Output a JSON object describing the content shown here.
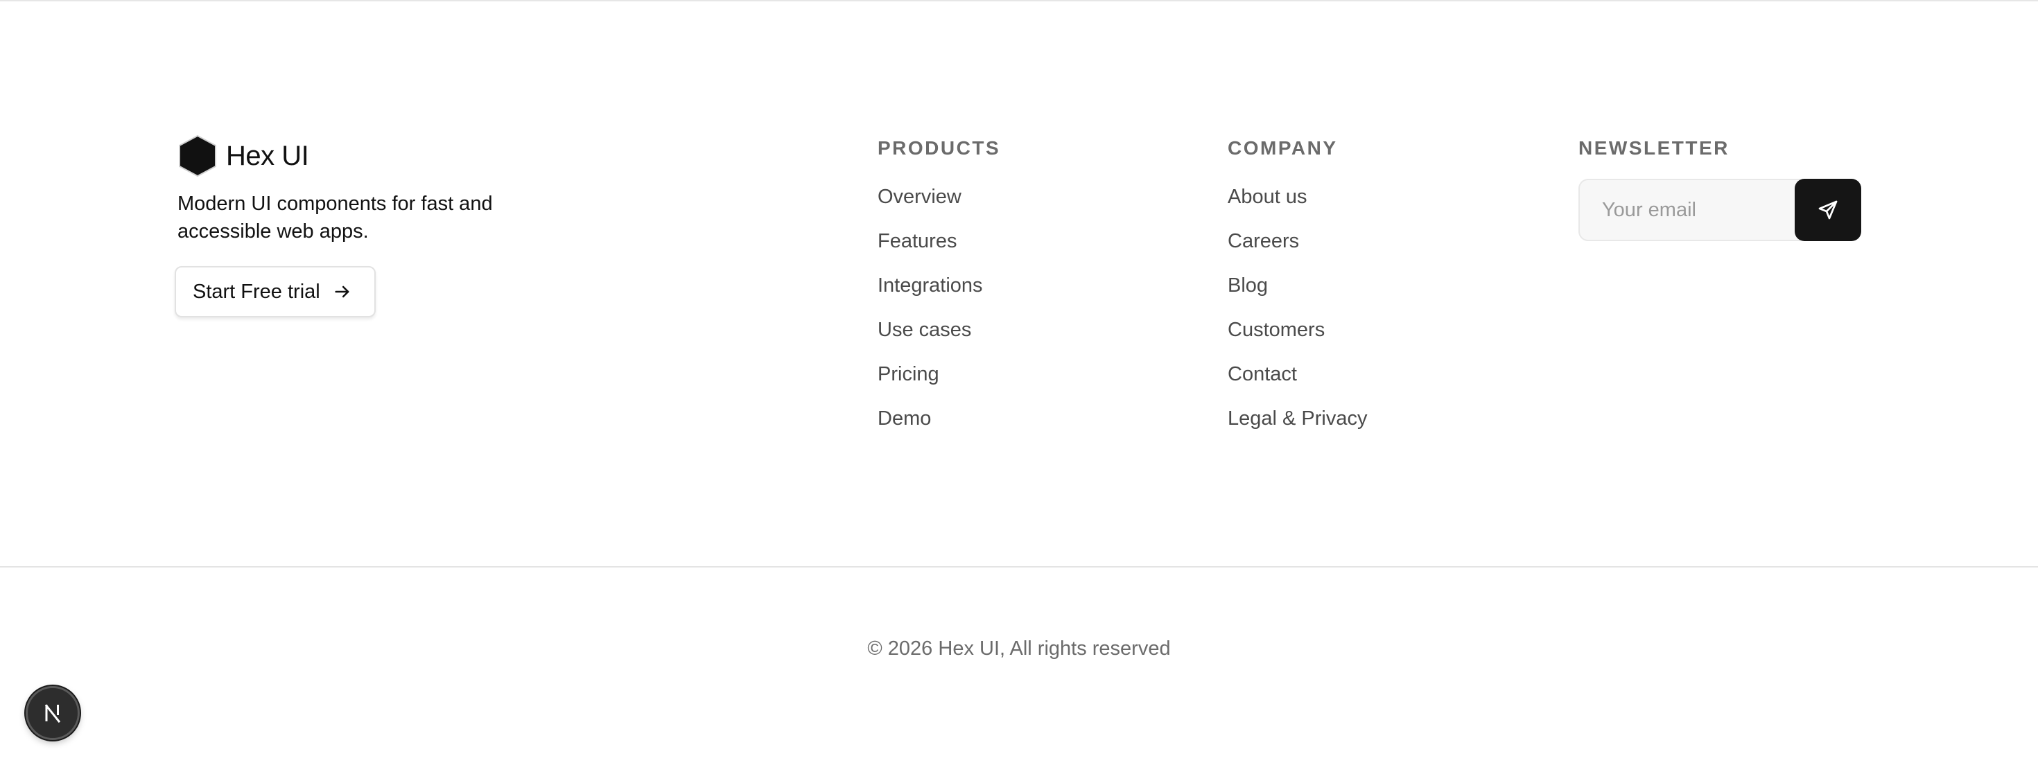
{
  "brand": {
    "name": "Hex UI",
    "logo_icon": "hexagon-icon",
    "tagline": "Modern UI components for fast and accessible web apps.",
    "cta_label": "Start Free trial",
    "cta_icon": "arrow-right-icon"
  },
  "products": {
    "heading": "PRODUCTS",
    "links": [
      "Overview",
      "Features",
      "Integrations",
      "Use cases",
      "Pricing",
      "Demo"
    ]
  },
  "company": {
    "heading": "COMPANY",
    "links": [
      "About us",
      "Careers",
      "Blog",
      "Customers",
      "Contact",
      "Legal & Privacy"
    ]
  },
  "newsletter": {
    "heading": "NEWSLETTER",
    "email_placeholder": "Your email",
    "email_value": "",
    "submit_icon": "send-icon"
  },
  "footer": {
    "copyright": "© 2026 Hex UI, All rights reserved"
  },
  "dev_badge": {
    "icon": "nextjs-logo-icon",
    "glyph": "N"
  },
  "colors": {
    "text": "#111111",
    "muted": "#6b6b6b",
    "link": "#4a4a4a",
    "button_dark": "#151515",
    "border": "#e4e4e4"
  }
}
